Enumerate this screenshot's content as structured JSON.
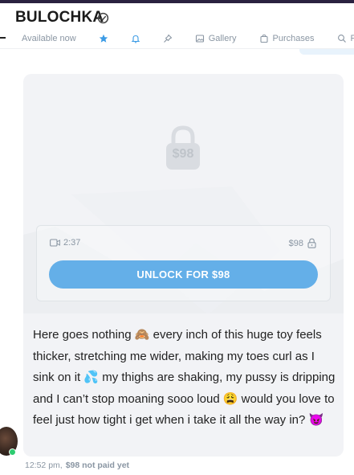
{
  "header": {
    "name": "BULOCHKA",
    "status": "Available now"
  },
  "toolbar": {
    "gallery": "Gallery",
    "purchases": "Purchases",
    "search_partial": "F"
  },
  "media": {
    "lock_price": "$98",
    "duration": "2:37",
    "price": "$98",
    "unlock_label": "UNLOCK FOR $98"
  },
  "message": {
    "text": "Here goes nothing 🙈 every inch of this huge toy feels thicker, stretching me wider, making my toes curl as I sink on it 💦 my thighs are shaking, my pussy is dripping and I can’t stop moaning sooo loud 😩 would you love to feel just how tight i get when i take it all the way in? 😈",
    "time": "12:52 pm,",
    "price_note": "$98 not paid yet"
  },
  "colors": {
    "accent": "#64afe8",
    "online": "#2ecc71",
    "muted": "#8a96a3",
    "bubble": "#f2f3f6"
  },
  "icons": [
    "check-circle-icon",
    "star-icon",
    "bell-icon",
    "pin-icon",
    "image-icon",
    "bag-icon",
    "search-icon",
    "lock-icon",
    "video-icon"
  ]
}
